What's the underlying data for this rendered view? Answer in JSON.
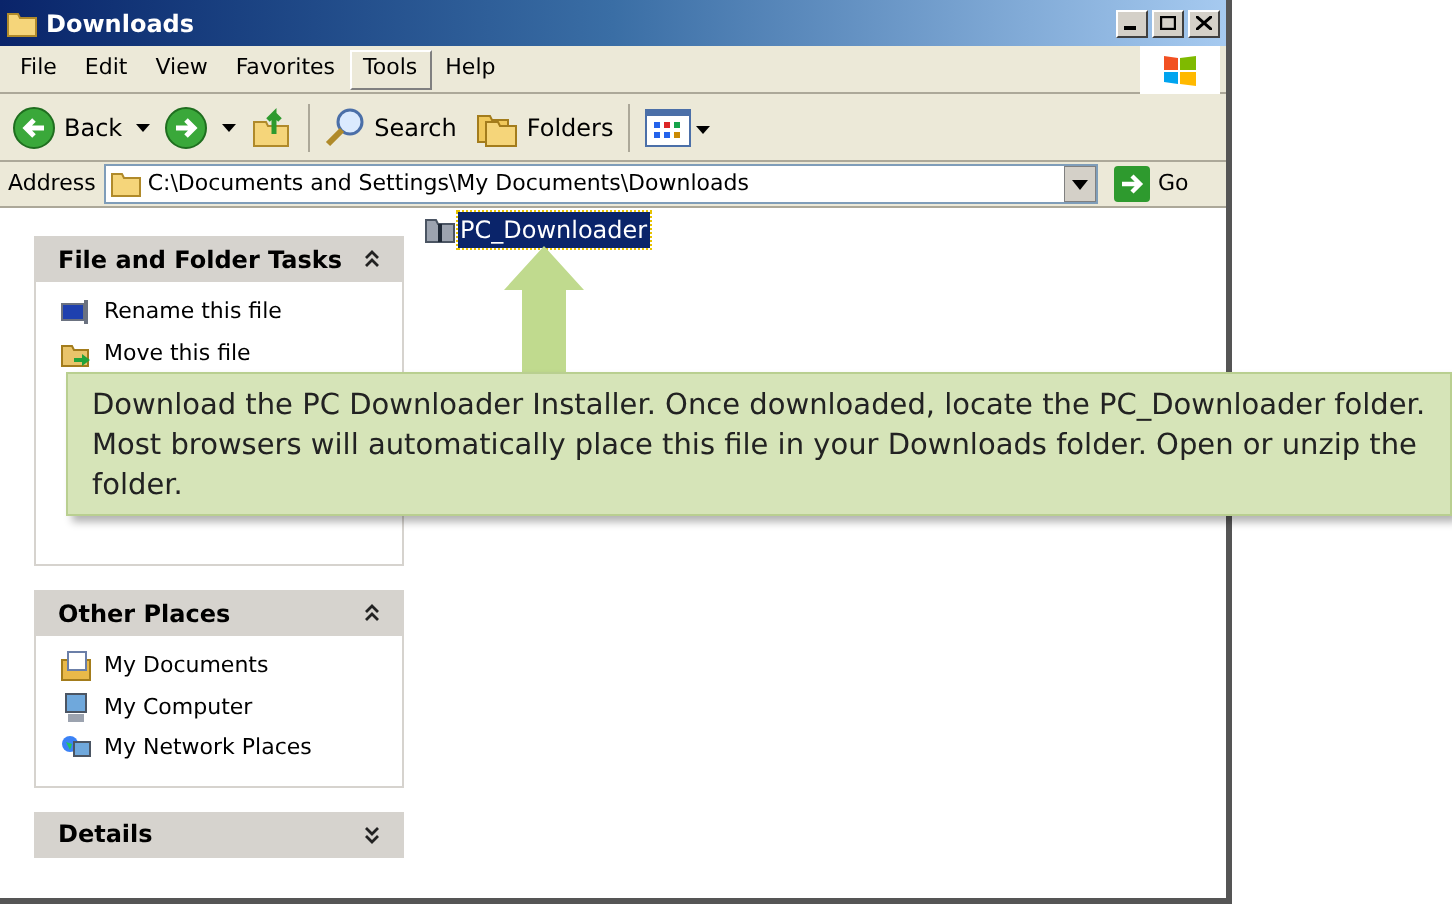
{
  "window": {
    "title": "Downloads"
  },
  "menu": [
    {
      "label": "File",
      "selected": false
    },
    {
      "label": "Edit",
      "selected": false
    },
    {
      "label": "View",
      "selected": false
    },
    {
      "label": "Favorites",
      "selected": false
    },
    {
      "label": "Tools",
      "selected": true
    },
    {
      "label": "Help",
      "selected": false
    }
  ],
  "toolbar": {
    "back": "Back",
    "search": "Search",
    "folders": "Folders"
  },
  "address": {
    "label": "Address",
    "value": "C:\\Documents and Settings\\My Documents\\Downloads",
    "go": "Go"
  },
  "panels": [
    {
      "title": "File and Folder Tasks",
      "expanded": true,
      "items": [
        {
          "label": "Rename this file"
        },
        {
          "label": "Move this file"
        }
      ]
    },
    {
      "title": "Other Places",
      "expanded": true,
      "items": [
        {
          "label": "My Documents"
        },
        {
          "label": "My Computer"
        },
        {
          "label": "My Network Places"
        }
      ]
    },
    {
      "title": "Details",
      "expanded": false
    }
  ],
  "files": [
    {
      "name": "PC_Downloader",
      "selected": true
    }
  ],
  "callout": {
    "text": "Download the PC Downloader Installer. Once downloaded, locate the PC_Downloader folder. Most browsers will automatically place this file in your Downloads folder. Open or unzip the folder."
  }
}
